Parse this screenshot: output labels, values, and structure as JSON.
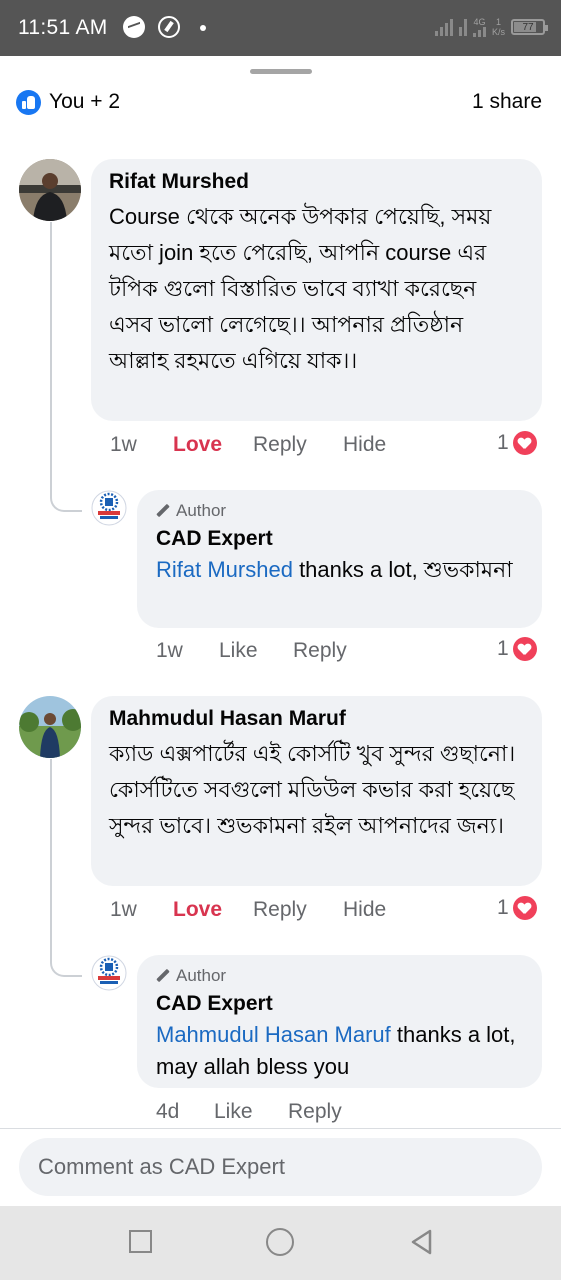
{
  "status_bar": {
    "time": "11:51 AM",
    "network_label": "4G",
    "speed_value": "1",
    "speed_unit": "K/s",
    "battery": "77",
    "battery_level": 0.77,
    "icons": [
      "messenger-icon",
      "sync-icon",
      "notification-dot-icon",
      "signal-icon",
      "battery-icon"
    ]
  },
  "post_summary": {
    "reactions": "You + 2",
    "shares": "1 share"
  },
  "comments": [
    {
      "author": "Rifat Murshed",
      "text": "Course থেকে অনেক উপকার পেয়েছি, সময় মতো join হতে পেরেছি, আপনি course এর টপিক গুলো বিস্তারিত ভাবে ব্যাখা করেছেন এসব ভালো লেগেছে।। আপনার প্রতিষ্ঠান আল্লাহ রহমতে এগিয়ে যাক।।",
      "time": "1w",
      "love_label": "Love",
      "reply_label": "Reply",
      "hide_label": "Hide",
      "reaction_count": "1",
      "reply": {
        "badge": "Author",
        "author": "CAD Expert",
        "mention": "Rifat Murshed",
        "text": " thanks a lot, শুভকামনা",
        "time": "1w",
        "like_label": "Like",
        "reply_label": "Reply",
        "reaction_count": "1"
      }
    },
    {
      "author": "Mahmudul Hasan Maruf",
      "text": "ক্যাড এক্সপার্টের এই কোর্সটি খুব সুন্দর গুছানো। কোর্সটিতে সবগুলো মডিউল কভার করা হয়েছে সুন্দর ভাবে। শুভকামনা রইল আপনাদের জন্য।",
      "time": "1w",
      "love_label": "Love",
      "reply_label": "Reply",
      "hide_label": "Hide",
      "reaction_count": "1",
      "reply": {
        "badge": "Author",
        "author": "CAD Expert",
        "mention": "Mahmudul Hasan Maruf",
        "text": " thanks a lot, may allah bless you",
        "time": "4d",
        "like_label": "Like",
        "reply_label": "Reply"
      }
    }
  ],
  "composer": {
    "placeholder": "Comment as CAD Expert"
  },
  "colors": {
    "status_bar": "#555555",
    "bubble": "#f0f2f5",
    "love": "#d8344f",
    "mention": "#1b6ac2",
    "like_blue": "#1877f2",
    "heart": "#f0405a"
  }
}
